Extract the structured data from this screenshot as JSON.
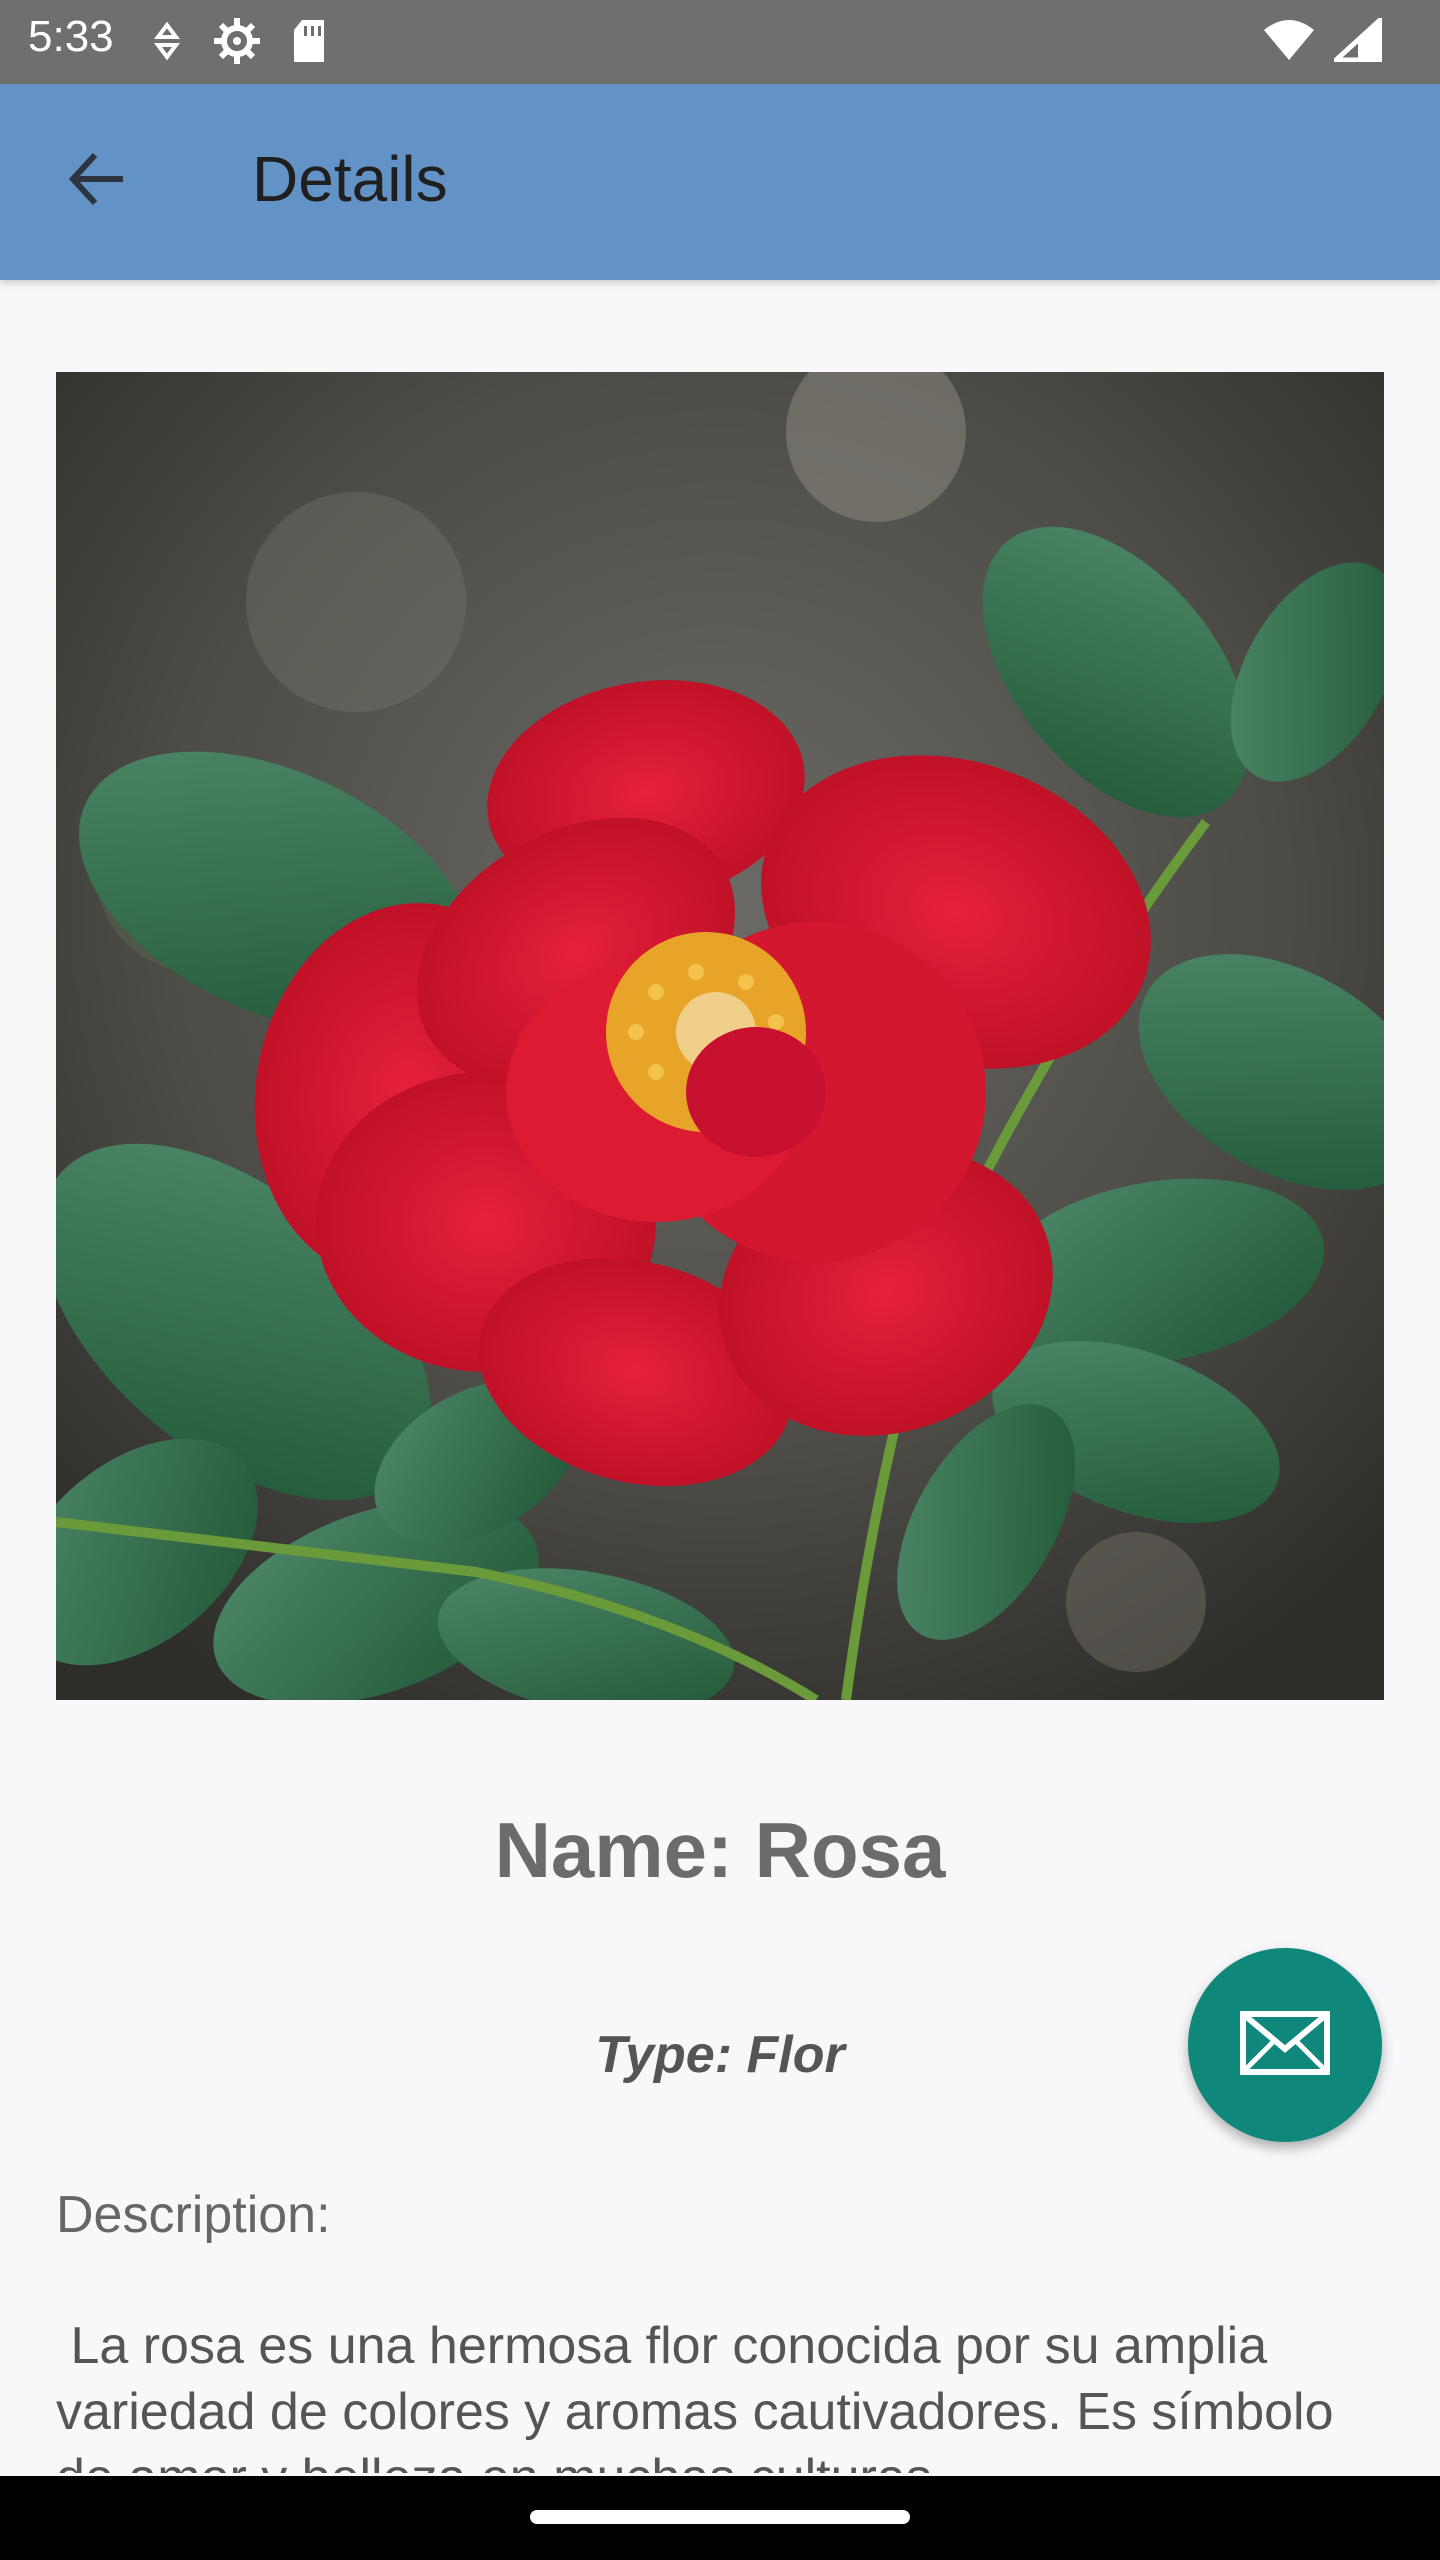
{
  "status_bar": {
    "time": "5:33",
    "icons_left": [
      "data-saver-icon",
      "settings-gear-icon",
      "sd-card-icon"
    ],
    "icons_right": [
      "wifi-icon",
      "signal-icon"
    ]
  },
  "app_bar": {
    "title": "Details",
    "back_icon": "arrow-back-icon",
    "color": "#6393c6"
  },
  "detail": {
    "image_alt": "red-rose-photo",
    "name": "Name: Rosa",
    "type": "Type: Flor",
    "description_label": "Description:",
    "description": " La rosa es una hermosa flor conocida por su amplia variedad de colores y aromas cautivadores. Es símbolo de amor y belleza en muchas culturas."
  },
  "fab": {
    "icon": "mail-icon",
    "color": "#0f877a"
  }
}
